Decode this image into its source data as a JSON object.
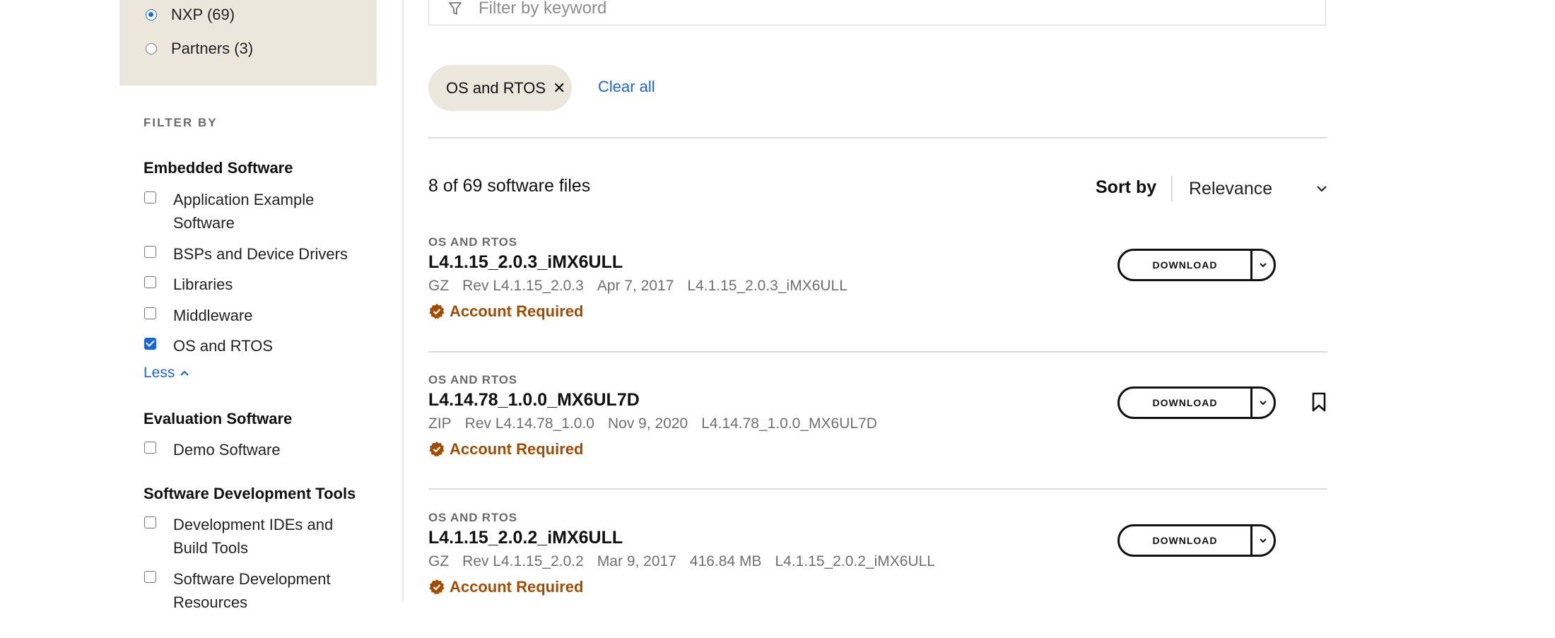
{
  "sidebar": {
    "source_options": [
      {
        "label": "NXP (69)",
        "selected": true
      },
      {
        "label": "Partners (3)",
        "selected": false
      }
    ],
    "filter_by_heading": "FILTER BY",
    "groups": {
      "embedded": {
        "title": "Embedded Software",
        "items": [
          {
            "label": "Application Example Software",
            "checked": false
          },
          {
            "label": "BSPs and Device Drivers",
            "checked": false
          },
          {
            "label": "Libraries",
            "checked": false
          },
          {
            "label": "Middleware",
            "checked": false
          },
          {
            "label": "OS and RTOS",
            "checked": true
          }
        ],
        "less_label": "Less"
      },
      "evaluation": {
        "title": "Evaluation Software",
        "items": [
          {
            "label": "Demo Software",
            "checked": false
          }
        ]
      },
      "devtools": {
        "title": "Software Development Tools",
        "items": [
          {
            "label": "Development IDEs and Build Tools",
            "checked": false
          },
          {
            "label": "Software Development Resources",
            "checked": false
          }
        ]
      }
    }
  },
  "search": {
    "placeholder": "Filter by keyword"
  },
  "active_filters": {
    "chips": [
      {
        "label": "OS and RTOS",
        "remove_icon": "✕"
      }
    ],
    "clear_all_label": "Clear all"
  },
  "results": {
    "count_text": "8 of 69 software files",
    "sort_label": "Sort by",
    "sort_value": "Relevance"
  },
  "items": [
    {
      "type": "OS AND RTOS",
      "title": "L4.1.15_2.0.3_iMX6ULL",
      "meta": {
        "format": "GZ",
        "rev": "Rev L4.1.15_2.0.3",
        "date": "Apr 7, 2017",
        "size": "",
        "filename": "L4.1.15_2.0.3_iMX6ULL"
      },
      "account_text": "Account Required",
      "download_label": "DOWNLOAD",
      "bookmark": false
    },
    {
      "type": "OS AND RTOS",
      "title": "L4.14.78_1.0.0_MX6UL7D",
      "meta": {
        "format": "ZIP",
        "rev": "Rev L4.14.78_1.0.0",
        "date": "Nov 9, 2020",
        "size": "",
        "filename": "L4.14.78_1.0.0_MX6UL7D"
      },
      "account_text": "Account Required",
      "download_label": "DOWNLOAD",
      "bookmark": true
    },
    {
      "type": "OS AND RTOS",
      "title": "L4.1.15_2.0.2_iMX6ULL",
      "meta": {
        "format": "GZ",
        "rev": "Rev L4.1.15_2.0.2",
        "date": "Mar 9, 2017",
        "size": "416.84 MB",
        "filename": "L4.1.15_2.0.2_iMX6ULL"
      },
      "account_text": "Account Required",
      "download_label": "DOWNLOAD",
      "bookmark": false
    }
  ],
  "colors": {
    "accent_blue": "#1a66d8",
    "account_orange": "#a34c00",
    "panel_beige": "#ece7dc"
  }
}
